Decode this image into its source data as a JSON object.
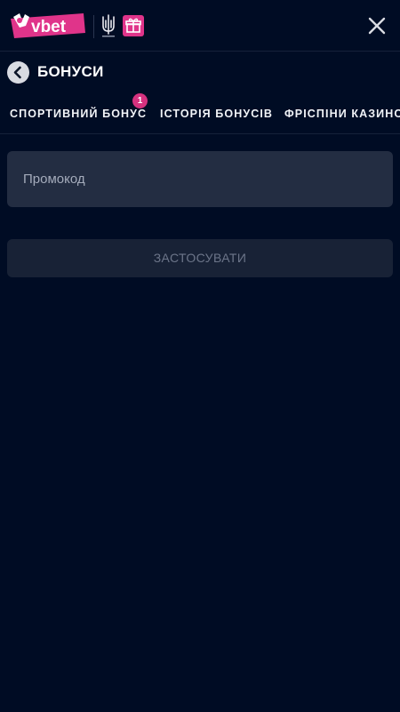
{
  "header": {
    "logo_text": "vbet",
    "brand_color": "#e0348a",
    "emblem_icon": "trident-icon",
    "gift_icon": "gift-icon",
    "close_icon": "close-icon"
  },
  "title_row": {
    "back_icon": "chevron-left-icon",
    "title": "БОНУСИ"
  },
  "tabs": [
    {
      "label": "СПОРТИВНИЙ БОНУС",
      "badge": "1"
    },
    {
      "label": "ІСТОРІЯ БОНУСІВ"
    },
    {
      "label": "ФРІСПІНИ КАЗИНО"
    }
  ],
  "promo": {
    "placeholder": "Промокод",
    "value": ""
  },
  "apply_button": {
    "label": "ЗАСТОСУВАТИ"
  },
  "colors": {
    "background": "#000c24",
    "input_bg": "#232d42",
    "button_bg": "#182236",
    "badge": "#d6327f"
  }
}
